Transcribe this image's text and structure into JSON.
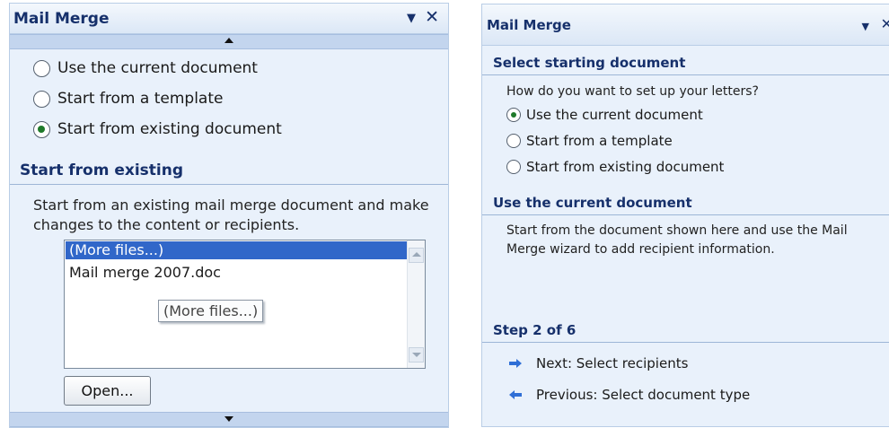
{
  "left_pane": {
    "title": "Mail Merge",
    "radio_options": [
      {
        "label": "Use the current document",
        "checked": false
      },
      {
        "label": "Start from a template",
        "checked": false
      },
      {
        "label": "Start from existing document",
        "checked": true
      }
    ],
    "section_heading": "Start from existing",
    "description": "Start from an existing mail merge document and make changes to the content or recipients.",
    "file_list": {
      "items": [
        "(More files...)",
        "Mail merge 2007.doc"
      ],
      "selected_index": 0,
      "tooltip": "(More files...)"
    },
    "open_button_label": "Open..."
  },
  "right_pane": {
    "title": "Mail Merge",
    "section_heading": "Select starting document",
    "question": "How do you want to set up your letters?",
    "radio_options": [
      {
        "label": "Use the current document",
        "checked": true
      },
      {
        "label": "Start from a template",
        "checked": false
      },
      {
        "label": "Start from existing document",
        "checked": false
      }
    ],
    "section2_heading": "Use the current document",
    "section2_desc_line1": "Start from the document shown here and use the Mail",
    "section2_desc_line2": "Merge wizard to add recipient information.",
    "step_heading": "Step 2 of 6",
    "next_link": "Next: Select recipients",
    "previous_link": "Previous: Select document type"
  },
  "colors": {
    "pane_bg": "#e9f1fb",
    "heading_text": "#16306b",
    "selection": "#3167c9",
    "radio_dot": "#1f7a2a",
    "nav_arrow": "#2f6fd6"
  },
  "icons": {
    "dropdown": "triangle-down-icon",
    "close": "close-icon",
    "next": "arrow-right-icon",
    "previous": "arrow-left-icon"
  }
}
